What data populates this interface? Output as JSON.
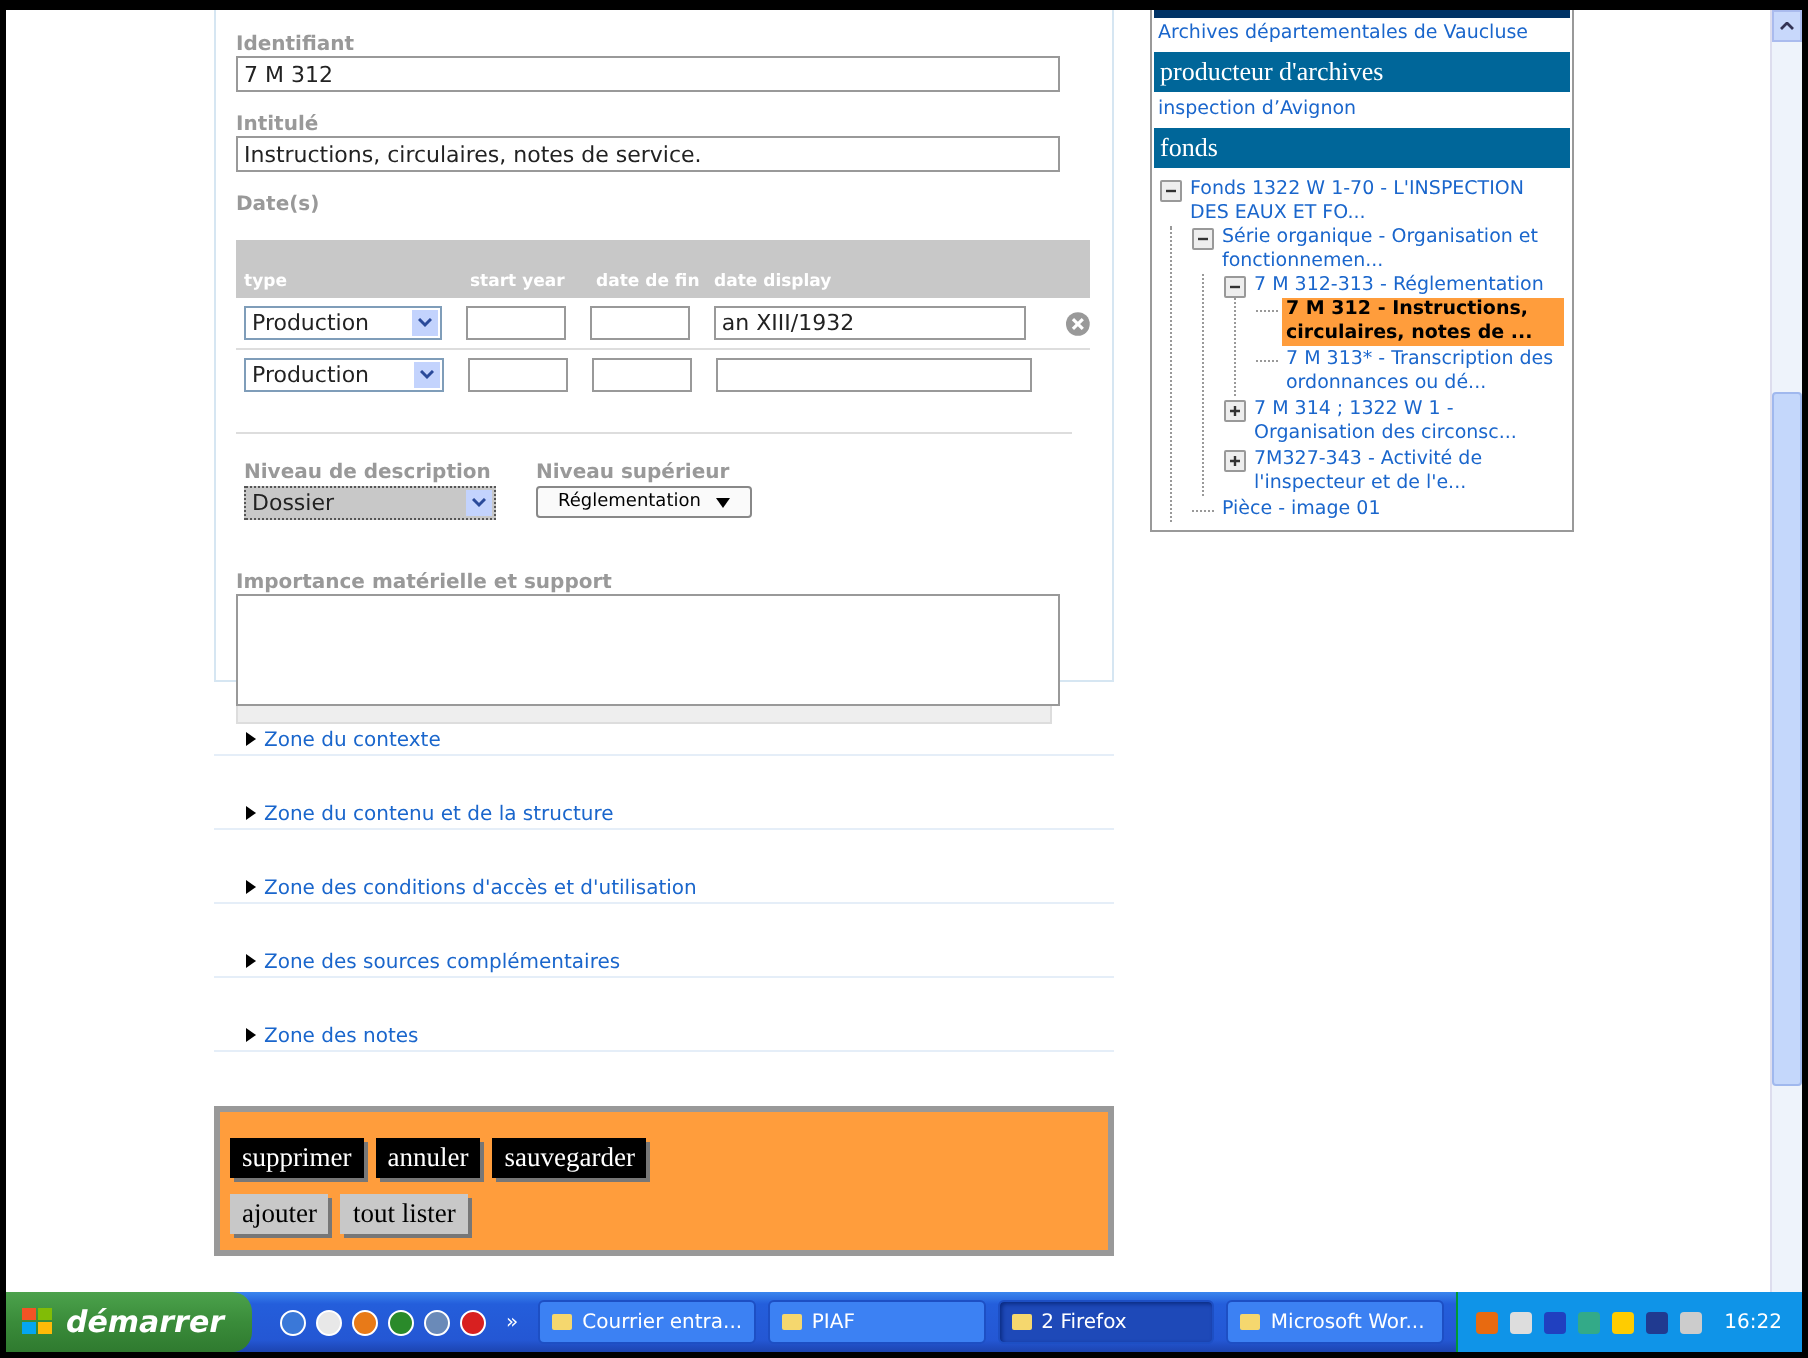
{
  "form": {
    "identifiant": {
      "label": "Identifiant",
      "value": "7 M 312"
    },
    "intitule": {
      "label": "Intitulé",
      "value": "Instructions, circulaires, notes de service."
    },
    "dates": {
      "label": "Date(s)",
      "columns": [
        "type",
        "start year",
        "date de fin",
        "date display"
      ],
      "rows": [
        {
          "type": "Production",
          "display": "an XIII/1932",
          "removable": true
        },
        {
          "type": "Production",
          "removable": false
        }
      ]
    },
    "niveau_description": {
      "label": "Niveau de description",
      "value": "Dossier",
      "disabled": true
    },
    "niveau_superieur": {
      "label": "Niveau supérieur",
      "value": "Réglementation"
    },
    "importance": {
      "label": "Importance matérielle et support"
    }
  },
  "zones": [
    {
      "label": "Zone du contexte"
    },
    {
      "label": "Zone du contenu et de la structure"
    },
    {
      "label": "Zone des conditions d'accès et d'utilisation"
    },
    {
      "label": "Zone des sources complémentaires"
    },
    {
      "label": "Zone des notes"
    }
  ],
  "actions": [
    {
      "label": "supprimer",
      "kind": "primary"
    },
    {
      "label": "annuler",
      "kind": "primary"
    },
    {
      "label": "sauvegarder",
      "kind": "primary"
    },
    {
      "label": "ajouter",
      "kind": "secondary"
    },
    {
      "label": "tout lister",
      "kind": "secondary"
    }
  ],
  "sidebar": {
    "service": "Archives départementales de Vaucluse",
    "producer_heading": "producteur d'archives",
    "producer": "inspection d’Avignon",
    "fonds_heading": "fonds",
    "tree": [
      {
        "label": "Fonds 1322 W 1-70 - L'INSPECTION DES EAUX ET FO...",
        "selected": false,
        "expanded": true,
        "children": [
          {
            "label": "Série organique - Organisation et fonctionnemen...",
            "selected": false,
            "expanded": true,
            "children": [
              {
                "label": "7 M 312-313 - Réglementation",
                "selected": false,
                "expanded": true,
                "children": [
                  {
                    "label": "7 M 312 - Instructions, circulaires, notes de ...",
                    "selected": true
                  },
                  {
                    "label": "7 M 313* - Transcription des ordonnances ou dé...",
                    "selected": false
                  }
                ]
              },
              {
                "label": "7 M 314 ; 1322 W 1 - Organisation des circonsc...",
                "selected": false,
                "expanded": false
              },
              {
                "label": "7M327-343 - Activité de l'inspecteur et de l'e...",
                "selected": false,
                "expanded": false
              }
            ]
          },
          {
            "label": "Pièce - image 01",
            "selected": false
          }
        ]
      }
    ]
  },
  "taskbar": {
    "start": "démarrer",
    "more": "»",
    "tasks": [
      {
        "label": "Courrier entra...",
        "selected": false
      },
      {
        "label": "PIAF",
        "selected": false
      },
      {
        "label": "2 Firefox",
        "selected": true
      },
      {
        "label": "Microsoft Wor...",
        "selected": false
      }
    ],
    "clock": "16:22"
  }
}
